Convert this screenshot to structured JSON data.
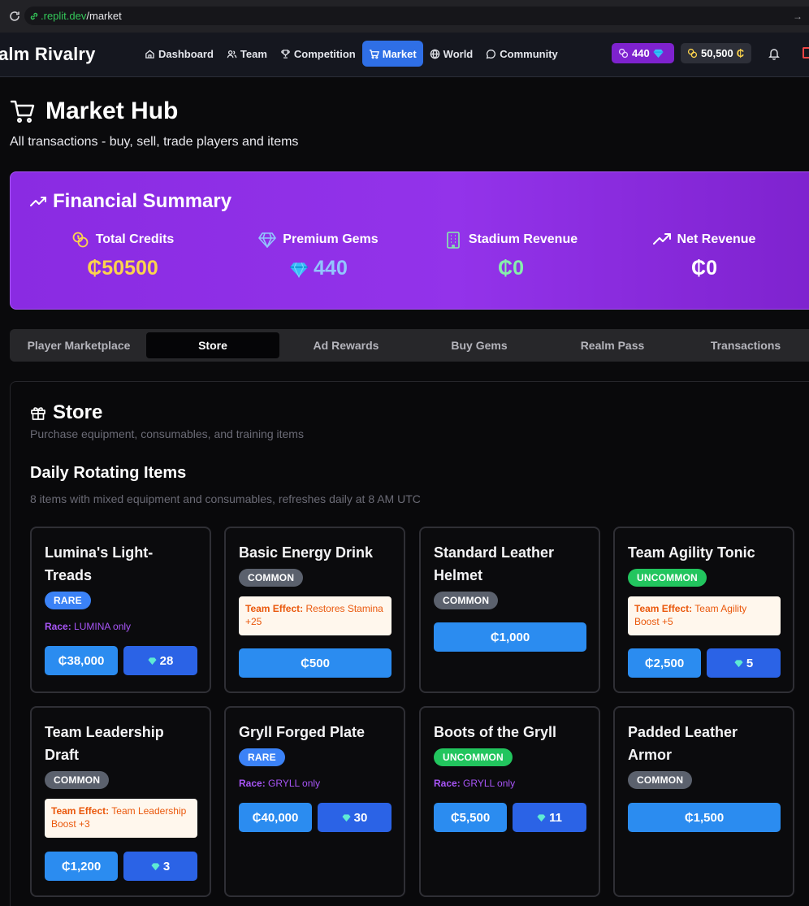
{
  "browser": {
    "url_domain": ".replit.dev",
    "url_path": "/market"
  },
  "header": {
    "brand": "alm Rivalry",
    "nav": [
      "Dashboard",
      "Team",
      "Competition",
      "Market",
      "World",
      "Community"
    ],
    "gems": "440",
    "credits": "50,500"
  },
  "page": {
    "title": "Market Hub",
    "subtitle": "All transactions - buy, sell, trade players and items"
  },
  "summary": {
    "title": "Financial Summary",
    "stats": [
      {
        "label": "Total Credits",
        "value": "₵50500"
      },
      {
        "label": "Premium Gems",
        "value": "440"
      },
      {
        "label": "Stadium Revenue",
        "value": "₵0"
      },
      {
        "label": "Net Revenue",
        "value": "₵0"
      }
    ]
  },
  "tabs": [
    "Player Marketplace",
    "Store",
    "Ad Rewards",
    "Buy Gems",
    "Realm Pass",
    "Transactions"
  ],
  "store": {
    "title": "Store",
    "desc": "Purchase equipment, consumables, and training items",
    "section_title": "Daily Rotating Items",
    "section_desc": "8 items with mixed equipment and consumables, refreshes daily at 8 AM UTC",
    "items": [
      {
        "name": "Lumina's Light-Treads",
        "rarity": "RARE",
        "race_label": "Race:",
        "race": "LUMINA only",
        "credit": "₵38,000",
        "gems": "28"
      },
      {
        "name": "Basic Energy Drink",
        "rarity": "COMMON",
        "effect_label": "Team Effect:",
        "effect": "Restores Stamina +25",
        "credit": "₵500"
      },
      {
        "name": "Standard Leather Helmet",
        "rarity": "COMMON",
        "credit": "₵1,000"
      },
      {
        "name": "Team Agility Tonic",
        "rarity": "UNCOMMON",
        "effect_label": "Team Effect:",
        "effect": "Team Agility Boost +5",
        "credit": "₵2,500",
        "gems": "5"
      },
      {
        "name": "Team Leadership Draft",
        "rarity": "COMMON",
        "effect_label": "Team Effect:",
        "effect": "Team Leadership Boost +3",
        "credit": "₵1,200",
        "gems": "3"
      },
      {
        "name": "Gryll Forged Plate",
        "rarity": "RARE",
        "race_label": "Race:",
        "race": "GRYLL only",
        "credit": "₵40,000",
        "gems": "30"
      },
      {
        "name": "Boots of the Gryll",
        "rarity": "UNCOMMON",
        "race_label": "Race:",
        "race": "GRYLL only",
        "credit": "₵5,500",
        "gems": "11"
      },
      {
        "name": "Padded Leather Armor",
        "rarity": "COMMON",
        "credit": "₵1,500"
      }
    ]
  }
}
